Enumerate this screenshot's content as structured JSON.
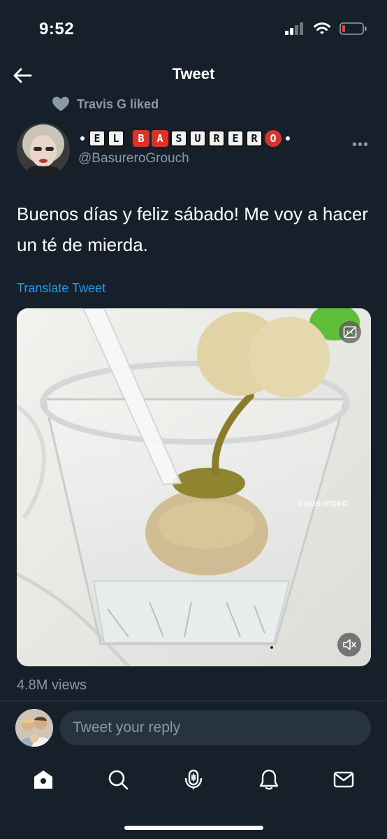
{
  "status_bar": {
    "time": "9:52"
  },
  "header": {
    "title": "Tweet"
  },
  "social_context": {
    "text": "Travis G liked"
  },
  "author": {
    "display_name": "•EL BASURERO•",
    "handle": "@BasureroGrouch"
  },
  "tweet": {
    "text": "Buenos días y feliz sábado! Me voy a hacer un té de mierda.",
    "translate_label": "Translate Tweet",
    "media_watermark": "COUB.VIDEO",
    "views": "4.8M views"
  },
  "reply": {
    "placeholder": "Tweet your reply"
  },
  "nav": {
    "items": [
      "home-icon",
      "search-icon",
      "spaces-icon",
      "notifications-icon",
      "messages-icon"
    ]
  },
  "colors": {
    "background": "#15202b",
    "accent": "#1d9bf0",
    "secondary_text": "#8b98a5",
    "reply_box": "#273340"
  }
}
